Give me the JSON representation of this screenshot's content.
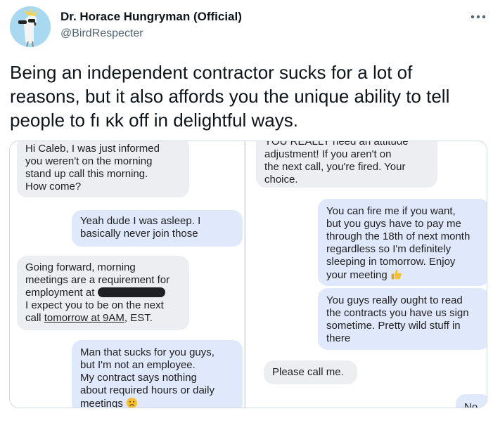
{
  "author": {
    "display_name": "Dr. Horace Hungryman (Official)",
    "handle": "@BirdRespecter"
  },
  "tweet": {
    "text_lines": [
      "Being an independent contractor sucks for a lot of",
      "reasons, but it also affords you the unique ability to tell",
      "people to fı ĸk off in delightful ways."
    ]
  },
  "screenshot": {
    "left": [
      {
        "lines": [
          "Hi Caleb, I was just informed",
          "you weren't on the morning",
          "stand up call this morning.",
          "How come?"
        ]
      },
      {
        "lines": [
          "Yeah dude I was asleep. I",
          "basically never join those"
        ]
      },
      {
        "lines": [
          "Going forward, morning",
          "meetings are a requirement for",
          "employment at",
          "I expect you to be on the next",
          "call",
          "tomorrow at 9AM",
          ", EST."
        ]
      },
      {
        "lines": [
          "Man that sucks for you guys,",
          "but I'm not an employee.",
          "My contract says nothing",
          "about required hours or daily",
          "meetings"
        ]
      }
    ],
    "right": [
      {
        "lines": [
          "YOU REALLY need an attitude",
          "adjustment! If you aren't on",
          "the next call, you're fired. Your",
          "choice."
        ]
      },
      {
        "lines": [
          "You can fire me if you want,",
          "but you guys have to pay me",
          "through the 18th of next month",
          "regardless so I'm definitely",
          "sleeping in tomorrow. Enjoy",
          "your meeting"
        ]
      },
      {
        "lines": [
          "You guys really ought to read",
          "the contracts you have us sign",
          "sometime. Pretty wild stuff in",
          "there"
        ]
      },
      {
        "lines": [
          "Please call me."
        ]
      },
      {
        "lines": [
          "No"
        ]
      }
    ]
  },
  "icons": {
    "more": "more-horizontal-icon",
    "thumbs_up": "thumbs-up-emoji-icon",
    "frown": "frowning-face-emoji-icon",
    "avatar": "cockatoo-avatar"
  },
  "colors": {
    "handle_gray": "#536471",
    "incoming_bubble": "#eceef1",
    "outgoing_bubble": "#dfe9fb",
    "emoji_yellow": "#f7c130"
  }
}
